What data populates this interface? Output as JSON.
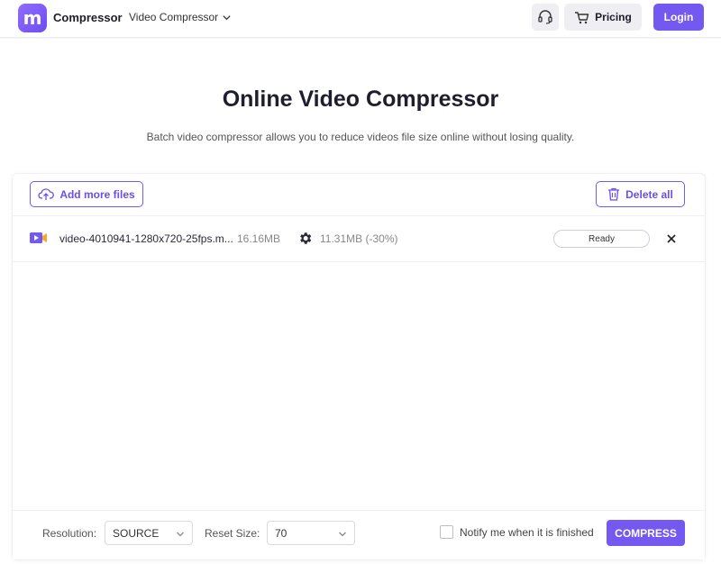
{
  "header": {
    "logo_letter": "m",
    "brand": "Compressor",
    "nav_dropdown": "Video Compressor",
    "pricing_label": "Pricing",
    "login_label": "Login"
  },
  "hero": {
    "title": "Online Video Compressor",
    "subtitle": "Batch video compressor allows you to reduce videos file size online without losing quality."
  },
  "toolbar": {
    "add_label": "Add more files",
    "delete_label": "Delete all"
  },
  "files": [
    {
      "name": "video-4010941-1280x720-25fps.m...",
      "original_size": "16.16MB",
      "compressed_size": "11.31MB (-30%)",
      "status": "Ready"
    }
  ],
  "settings": {
    "resolution_label": "Resolution:",
    "resolution_value": "SOURCE",
    "reset_size_label": "Reset Size:",
    "reset_size_value": "70",
    "notify_label": "Notify me when it is finished",
    "compress_label": "COMPRESS"
  },
  "colors": {
    "accent": "#7459f1",
    "accent_text": "#6b4fe6",
    "background": "#f5f5f7"
  }
}
